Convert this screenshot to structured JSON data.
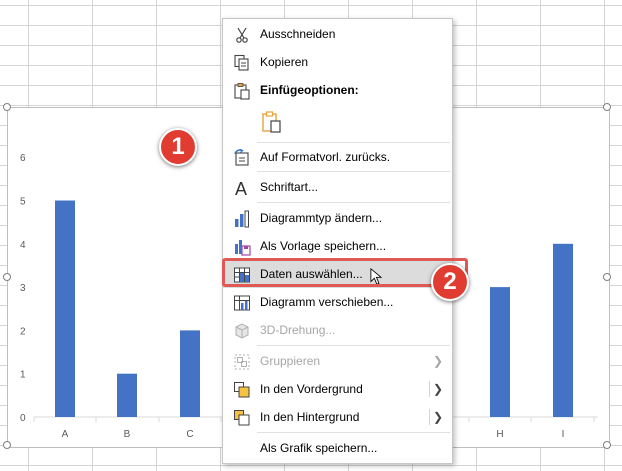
{
  "menu": {
    "items": [
      {
        "label": "Ausschneiden",
        "icon": "scissors-icon",
        "enabled": true
      },
      {
        "label": "Kopieren",
        "icon": "copy-icon",
        "enabled": true
      },
      {
        "label": "Einfügeoptionen:",
        "icon": "paste-options-icon",
        "enabled": true
      },
      {
        "label": "",
        "icon": "paste-icon",
        "enabled": true
      },
      {
        "label": "Auf Formatvorl. zurücks.",
        "icon": "reset-style-icon",
        "enabled": true
      },
      {
        "label": "Schriftart...",
        "icon": "font-icon",
        "enabled": true
      },
      {
        "label": "Diagrammtyp ändern...",
        "icon": "chart-type-icon",
        "enabled": true
      },
      {
        "label": "Als Vorlage speichern...",
        "icon": "save-template-icon",
        "enabled": true
      },
      {
        "label": "Daten auswählen...",
        "icon": "select-data-icon",
        "enabled": true
      },
      {
        "label": "Diagramm verschieben...",
        "icon": "move-chart-icon",
        "enabled": true
      },
      {
        "label": "3D-Drehung...",
        "icon": "3d-rotation-icon",
        "enabled": false
      },
      {
        "label": "Gruppieren",
        "icon": "group-icon",
        "enabled": false
      },
      {
        "label": "In den Vordergrund",
        "icon": "bring-forward-icon",
        "enabled": true
      },
      {
        "label": "In den Hintergrund",
        "icon": "send-backward-icon",
        "enabled": true
      },
      {
        "label": "Als Grafik speichern...",
        "icon": "",
        "enabled": true
      }
    ]
  },
  "badges": {
    "one": "1",
    "two": "2"
  },
  "colors": {
    "bar": "#4472c4",
    "badge": "#e03c31",
    "highlight": "#e05a55"
  },
  "chart_data": {
    "type": "bar",
    "categories": [
      "A",
      "B",
      "C",
      "H",
      "I"
    ],
    "values": [
      5,
      1,
      2,
      3,
      4
    ],
    "ylim": [
      0,
      6
    ],
    "yticks": [
      "0",
      "1",
      "2",
      "3",
      "4",
      "5",
      "6"
    ],
    "grid": false,
    "title": "",
    "xlabel": "",
    "ylabel": ""
  }
}
